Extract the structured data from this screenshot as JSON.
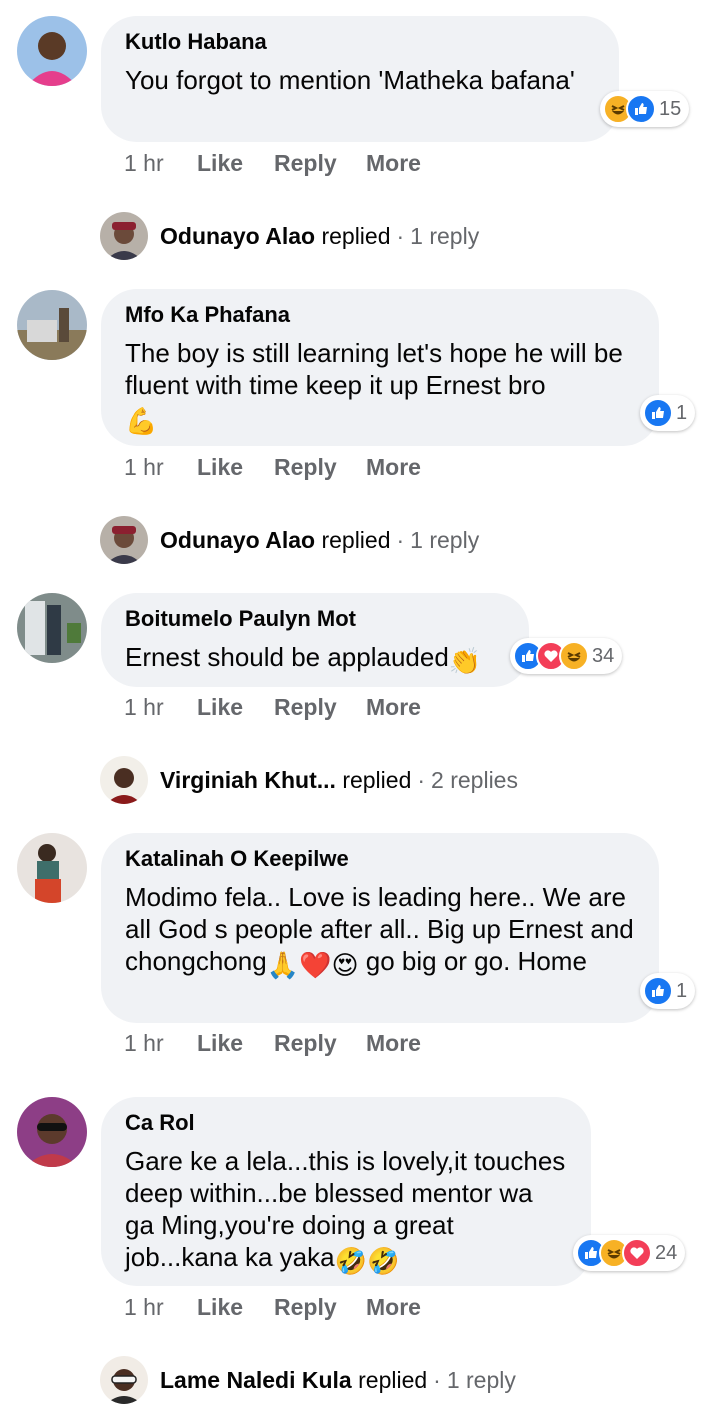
{
  "comments": [
    {
      "author": "Kutlo Habana",
      "text": "You forgot to mention 'Matheka bafana'",
      "reaction_count": "15",
      "reactions": [
        "haha",
        "like"
      ],
      "time": "1 hr",
      "like_label": "Like",
      "reply_label": "Reply",
      "more_label": "More",
      "reply_thread": {
        "name": "Odunayo Alao",
        "verb": "replied",
        "separator": "·",
        "count": "1 reply"
      }
    },
    {
      "author": "Mfo Ka Phafana",
      "text": "The boy is still learning let's hope he will be fluent with time keep it up Ernest bro",
      "text_emoji": "💪",
      "reaction_count": "1",
      "reactions": [
        "like"
      ],
      "time": "1 hr",
      "like_label": "Like",
      "reply_label": "Reply",
      "more_label": "More",
      "reply_thread": {
        "name": "Odunayo Alao",
        "verb": "replied",
        "separator": "·",
        "count": "1 reply"
      }
    },
    {
      "author": "Boitumelo Paulyn Mot",
      "text": "Ernest should be applauded",
      "text_emoji": "👏",
      "reaction_count": "34",
      "reactions": [
        "like",
        "love",
        "haha"
      ],
      "time": "1 hr",
      "like_label": "Like",
      "reply_label": "Reply",
      "more_label": "More",
      "reply_thread": {
        "name": "Virginiah Khut...",
        "verb": "replied",
        "separator": "·",
        "count": "2 replies"
      }
    },
    {
      "author": "Katalinah O Keepilwe",
      "text_parts": [
        "Modimo fela.. Love is leading here.. We are all God s people after all.. Big up Ernest and chongchong",
        "go big or go. Home"
      ],
      "text_emojis": [
        "🙏",
        "❤️",
        "😍"
      ],
      "reaction_count": "1",
      "reactions": [
        "like"
      ],
      "time": "1 hr",
      "like_label": "Like",
      "reply_label": "Reply",
      "more_label": "More"
    },
    {
      "author": "Ca Rol",
      "text": "Gare ke a lela...this is lovely,it touches deep within...be blessed mentor wa ga Ming,you're doing a great job...kana ka yaka",
      "text_emoji": "🤣🤣",
      "reaction_count": "24",
      "reactions": [
        "like",
        "haha",
        "love"
      ],
      "time": "1 hr",
      "like_label": "Like",
      "reply_label": "Reply",
      "more_label": "More",
      "reply_thread": {
        "name": "Lame Naledi Kula",
        "verb": "replied",
        "separator": "·",
        "count": "1 reply"
      }
    }
  ],
  "colors": {
    "bubble": "#f0f2f5",
    "meta": "#65676b",
    "like": "#1877f2",
    "haha": "#f7b125",
    "love": "#f33e58"
  },
  "icons": {
    "like": "thumbs-up-icon",
    "haha": "laughing-face-icon",
    "love": "heart-icon"
  }
}
